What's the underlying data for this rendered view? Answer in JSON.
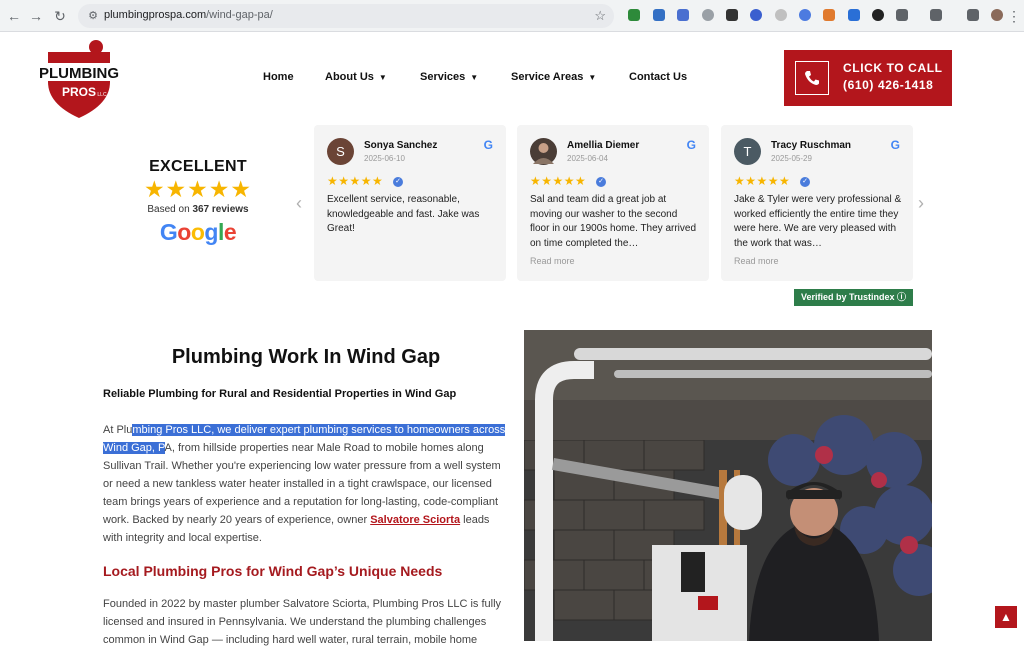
{
  "browser": {
    "url_host": "plumbingprospa.com",
    "url_path": "/wind-gap-pa/"
  },
  "logo": {
    "line1": "PLUMBING",
    "line2": "PROS",
    "line3": "LLC"
  },
  "nav": {
    "home": "Home",
    "about": "About Us",
    "services": "Services",
    "service_areas": "Service Areas",
    "contact": "Contact Us"
  },
  "cta": {
    "label": "CLICK TO CALL",
    "phone": "(610) 426-1418"
  },
  "reviews_summary": {
    "rating_word": "EXCELLENT",
    "stars": "★★★★★",
    "based_prefix": "Based on ",
    "count": "367 reviews",
    "google": [
      "G",
      "o",
      "o",
      "g",
      "l",
      "e"
    ]
  },
  "reviews": [
    {
      "initial": "S",
      "name": "Sonya Sanchez",
      "date": "2025-06-10",
      "stars": "★★★★★",
      "text": "Excellent service, reasonable, knowledgeable and fast. Jake was Great!",
      "read_more": ""
    },
    {
      "initial": "",
      "name": "Amellia Diemer",
      "date": "2025-06-04",
      "stars": "★★★★★",
      "text": "Sal and team did a great job at moving our washer to the second floor in our 1900s home. They arrived on time completed the…",
      "read_more": "Read more"
    },
    {
      "initial": "T",
      "name": "Tracy Ruschman",
      "date": "2025-05-29",
      "stars": "★★★★★",
      "text": "Jake & Tyler were very professional & worked efficiently the entire time they were here. We are very pleased with the work that was…",
      "read_more": "Read more"
    }
  ],
  "trust_badge": "Verified by Trustindex ⓘ",
  "article": {
    "title": "Plumbing Work In Wind Gap",
    "subtitle": "Reliable Plumbing for Rural and Residential Properties in Wind Gap",
    "p1_a": "At Plu",
    "p1_hl": "mbing Pros LLC, we deliver expert plumbing services to homeowners across Wind Gap, P",
    "p1_b": "A, from hillside properties near Male Road to mobile homes along Sullivan Trail. Whether you're experiencing low water pressure from a well system or need a new tankless water heater installed in a tight crawlspace, our licensed team brings years of experience and a reputation for long-lasting, code-compliant work. Backed by nearly 20 years of experience, owner ",
    "p1_link": "Salvatore Sciorta",
    "p1_c": " leads with integrity and local expertise.",
    "h2": "Local Plumbing Pros for Wind Gap’s Unique Needs",
    "p2": "Founded in 2022 by master plumber Salvatore Sciorta, Plumbing Pros LLC is fully licensed and insured in Pennsylvania. We understand the plumbing challenges common in Wind Gap — including hard well water, rural terrain, mobile home"
  },
  "colors": {
    "brand_red": "#b3161c",
    "heading_red": "#a51a1f",
    "star": "#f7b500",
    "trust_green": "#2e7d4a"
  }
}
